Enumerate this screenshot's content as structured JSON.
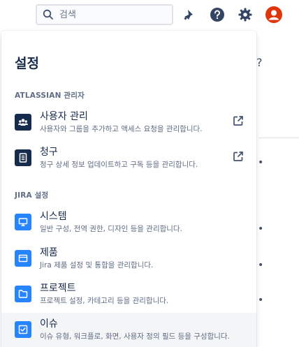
{
  "topbar": {
    "search_placeholder": "검색",
    "icons": [
      "search-icon",
      "notification-icon",
      "help-icon",
      "settings-icon",
      "profile-icon"
    ],
    "brand_color": "#0052CC",
    "avatar_color": "#DE350B"
  },
  "background": {
    "question_mark": "?",
    "bullets": [
      "•",
      "•",
      "•",
      "•"
    ]
  },
  "settings_menu": {
    "title": "설정",
    "sections": [
      {
        "header": "ATLASSIAN 관리자",
        "items": [
          {
            "label": "사용자 관리",
            "description": "사용자와 그룹을 추가하고 액세스 요청을 관리합니다.",
            "icon": "users-icon",
            "external": true
          },
          {
            "label": "청구",
            "description": "청구 상세 정보 업데이트하고 구독 등을 관리합니다.",
            "icon": "billing-icon",
            "external": true
          }
        ]
      },
      {
        "header": "JIRA 설정",
        "items": [
          {
            "label": "시스템",
            "description": "일반 구성, 전역 권한, 디자인 등을 관리합니다.",
            "icon": "system-icon",
            "external": false
          },
          {
            "label": "제품",
            "description": "Jira 제품 설정 및 통합을 관리합니다.",
            "icon": "products-icon",
            "external": false
          },
          {
            "label": "프로젝트",
            "description": "프로젝트 설정, 카테고리 등을 관리합니다.",
            "icon": "projects-icon",
            "external": false
          },
          {
            "label": "이슈",
            "description": "이슈 유형, 워크플로, 화면, 사용자 정의 필드 등을 구성합니다.",
            "icon": "issues-icon",
            "external": false
          }
        ]
      }
    ]
  }
}
